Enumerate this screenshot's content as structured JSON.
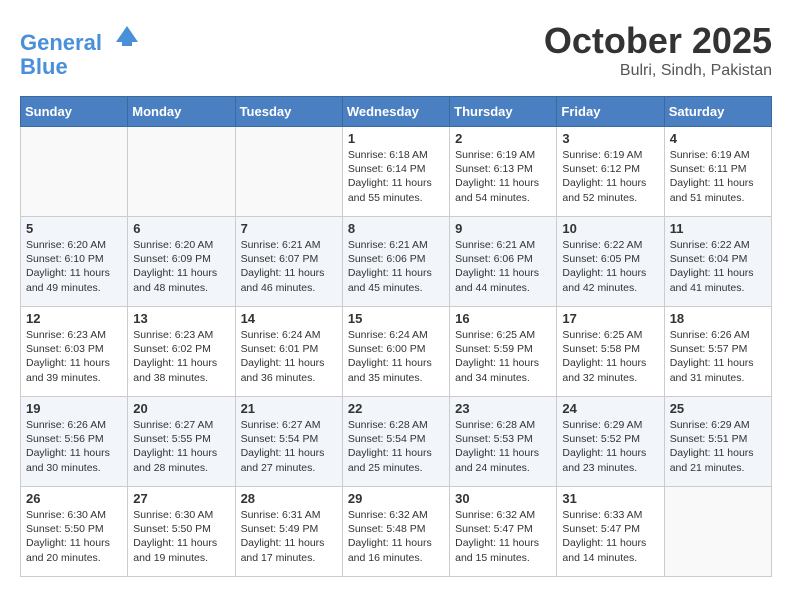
{
  "header": {
    "logo_line1": "General",
    "logo_line2": "Blue",
    "month": "October 2025",
    "location": "Bulri, Sindh, Pakistan"
  },
  "weekdays": [
    "Sunday",
    "Monday",
    "Tuesday",
    "Wednesday",
    "Thursday",
    "Friday",
    "Saturday"
  ],
  "weeks": [
    [
      {
        "day": "",
        "info": ""
      },
      {
        "day": "",
        "info": ""
      },
      {
        "day": "",
        "info": ""
      },
      {
        "day": "1",
        "info": "Sunrise: 6:18 AM\nSunset: 6:14 PM\nDaylight: 11 hours\nand 55 minutes."
      },
      {
        "day": "2",
        "info": "Sunrise: 6:19 AM\nSunset: 6:13 PM\nDaylight: 11 hours\nand 54 minutes."
      },
      {
        "day": "3",
        "info": "Sunrise: 6:19 AM\nSunset: 6:12 PM\nDaylight: 11 hours\nand 52 minutes."
      },
      {
        "day": "4",
        "info": "Sunrise: 6:19 AM\nSunset: 6:11 PM\nDaylight: 11 hours\nand 51 minutes."
      }
    ],
    [
      {
        "day": "5",
        "info": "Sunrise: 6:20 AM\nSunset: 6:10 PM\nDaylight: 11 hours\nand 49 minutes."
      },
      {
        "day": "6",
        "info": "Sunrise: 6:20 AM\nSunset: 6:09 PM\nDaylight: 11 hours\nand 48 minutes."
      },
      {
        "day": "7",
        "info": "Sunrise: 6:21 AM\nSunset: 6:07 PM\nDaylight: 11 hours\nand 46 minutes."
      },
      {
        "day": "8",
        "info": "Sunrise: 6:21 AM\nSunset: 6:06 PM\nDaylight: 11 hours\nand 45 minutes."
      },
      {
        "day": "9",
        "info": "Sunrise: 6:21 AM\nSunset: 6:06 PM\nDaylight: 11 hours\nand 44 minutes."
      },
      {
        "day": "10",
        "info": "Sunrise: 6:22 AM\nSunset: 6:05 PM\nDaylight: 11 hours\nand 42 minutes."
      },
      {
        "day": "11",
        "info": "Sunrise: 6:22 AM\nSunset: 6:04 PM\nDaylight: 11 hours\nand 41 minutes."
      }
    ],
    [
      {
        "day": "12",
        "info": "Sunrise: 6:23 AM\nSunset: 6:03 PM\nDaylight: 11 hours\nand 39 minutes."
      },
      {
        "day": "13",
        "info": "Sunrise: 6:23 AM\nSunset: 6:02 PM\nDaylight: 11 hours\nand 38 minutes."
      },
      {
        "day": "14",
        "info": "Sunrise: 6:24 AM\nSunset: 6:01 PM\nDaylight: 11 hours\nand 36 minutes."
      },
      {
        "day": "15",
        "info": "Sunrise: 6:24 AM\nSunset: 6:00 PM\nDaylight: 11 hours\nand 35 minutes."
      },
      {
        "day": "16",
        "info": "Sunrise: 6:25 AM\nSunset: 5:59 PM\nDaylight: 11 hours\nand 34 minutes."
      },
      {
        "day": "17",
        "info": "Sunrise: 6:25 AM\nSunset: 5:58 PM\nDaylight: 11 hours\nand 32 minutes."
      },
      {
        "day": "18",
        "info": "Sunrise: 6:26 AM\nSunset: 5:57 PM\nDaylight: 11 hours\nand 31 minutes."
      }
    ],
    [
      {
        "day": "19",
        "info": "Sunrise: 6:26 AM\nSunset: 5:56 PM\nDaylight: 11 hours\nand 30 minutes."
      },
      {
        "day": "20",
        "info": "Sunrise: 6:27 AM\nSunset: 5:55 PM\nDaylight: 11 hours\nand 28 minutes."
      },
      {
        "day": "21",
        "info": "Sunrise: 6:27 AM\nSunset: 5:54 PM\nDaylight: 11 hours\nand 27 minutes."
      },
      {
        "day": "22",
        "info": "Sunrise: 6:28 AM\nSunset: 5:54 PM\nDaylight: 11 hours\nand 25 minutes."
      },
      {
        "day": "23",
        "info": "Sunrise: 6:28 AM\nSunset: 5:53 PM\nDaylight: 11 hours\nand 24 minutes."
      },
      {
        "day": "24",
        "info": "Sunrise: 6:29 AM\nSunset: 5:52 PM\nDaylight: 11 hours\nand 23 minutes."
      },
      {
        "day": "25",
        "info": "Sunrise: 6:29 AM\nSunset: 5:51 PM\nDaylight: 11 hours\nand 21 minutes."
      }
    ],
    [
      {
        "day": "26",
        "info": "Sunrise: 6:30 AM\nSunset: 5:50 PM\nDaylight: 11 hours\nand 20 minutes."
      },
      {
        "day": "27",
        "info": "Sunrise: 6:30 AM\nSunset: 5:50 PM\nDaylight: 11 hours\nand 19 minutes."
      },
      {
        "day": "28",
        "info": "Sunrise: 6:31 AM\nSunset: 5:49 PM\nDaylight: 11 hours\nand 17 minutes."
      },
      {
        "day": "29",
        "info": "Sunrise: 6:32 AM\nSunset: 5:48 PM\nDaylight: 11 hours\nand 16 minutes."
      },
      {
        "day": "30",
        "info": "Sunrise: 6:32 AM\nSunset: 5:47 PM\nDaylight: 11 hours\nand 15 minutes."
      },
      {
        "day": "31",
        "info": "Sunrise: 6:33 AM\nSunset: 5:47 PM\nDaylight: 11 hours\nand 14 minutes."
      },
      {
        "day": "",
        "info": ""
      }
    ]
  ]
}
